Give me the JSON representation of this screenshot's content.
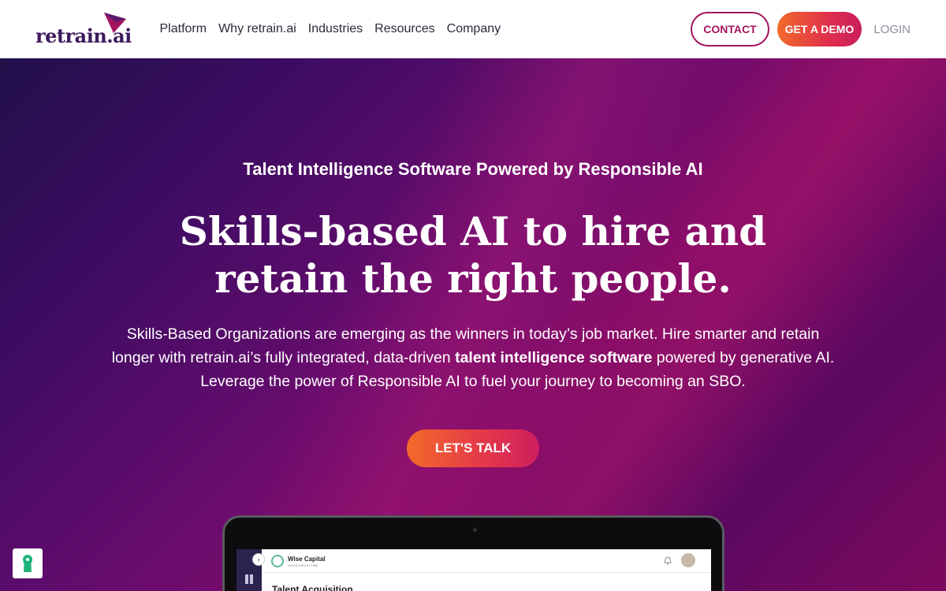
{
  "brand": {
    "name": "retrain.ai"
  },
  "nav": {
    "items": [
      {
        "label": "Platform"
      },
      {
        "label": "Why retrain.ai"
      },
      {
        "label": "Industries"
      },
      {
        "label": "Resources"
      },
      {
        "label": "Company"
      }
    ]
  },
  "header_actions": {
    "contact": "CONTACT",
    "demo": "GET A DEMO",
    "login": "LOGIN"
  },
  "hero": {
    "tagline": "Talent Intelligence Software Powered by Responsible AI",
    "headline": "Skills-based AI to hire and retain the right people.",
    "description_before": "Skills-Based Organizations are emerging as the winners in today’s job market. Hire smarter and retain longer with retrain.ai’s fully integrated, data-driven ",
    "description_bold": "talent intelligence software",
    "description_after": " powered by generative AI. Leverage the power of Responsible AI to fuel your journey to becoming an SBO.",
    "cta": "LET'S TALK"
  },
  "mockup": {
    "company_name": "Wise Capital",
    "company_tagline": "INVESTORS IN TIME",
    "section_heading": "Talent Acquisition"
  },
  "colors": {
    "brand_purple": "#3d1a5e",
    "accent_magenta": "#a3145e",
    "accent_orange": "#f26a2a"
  }
}
